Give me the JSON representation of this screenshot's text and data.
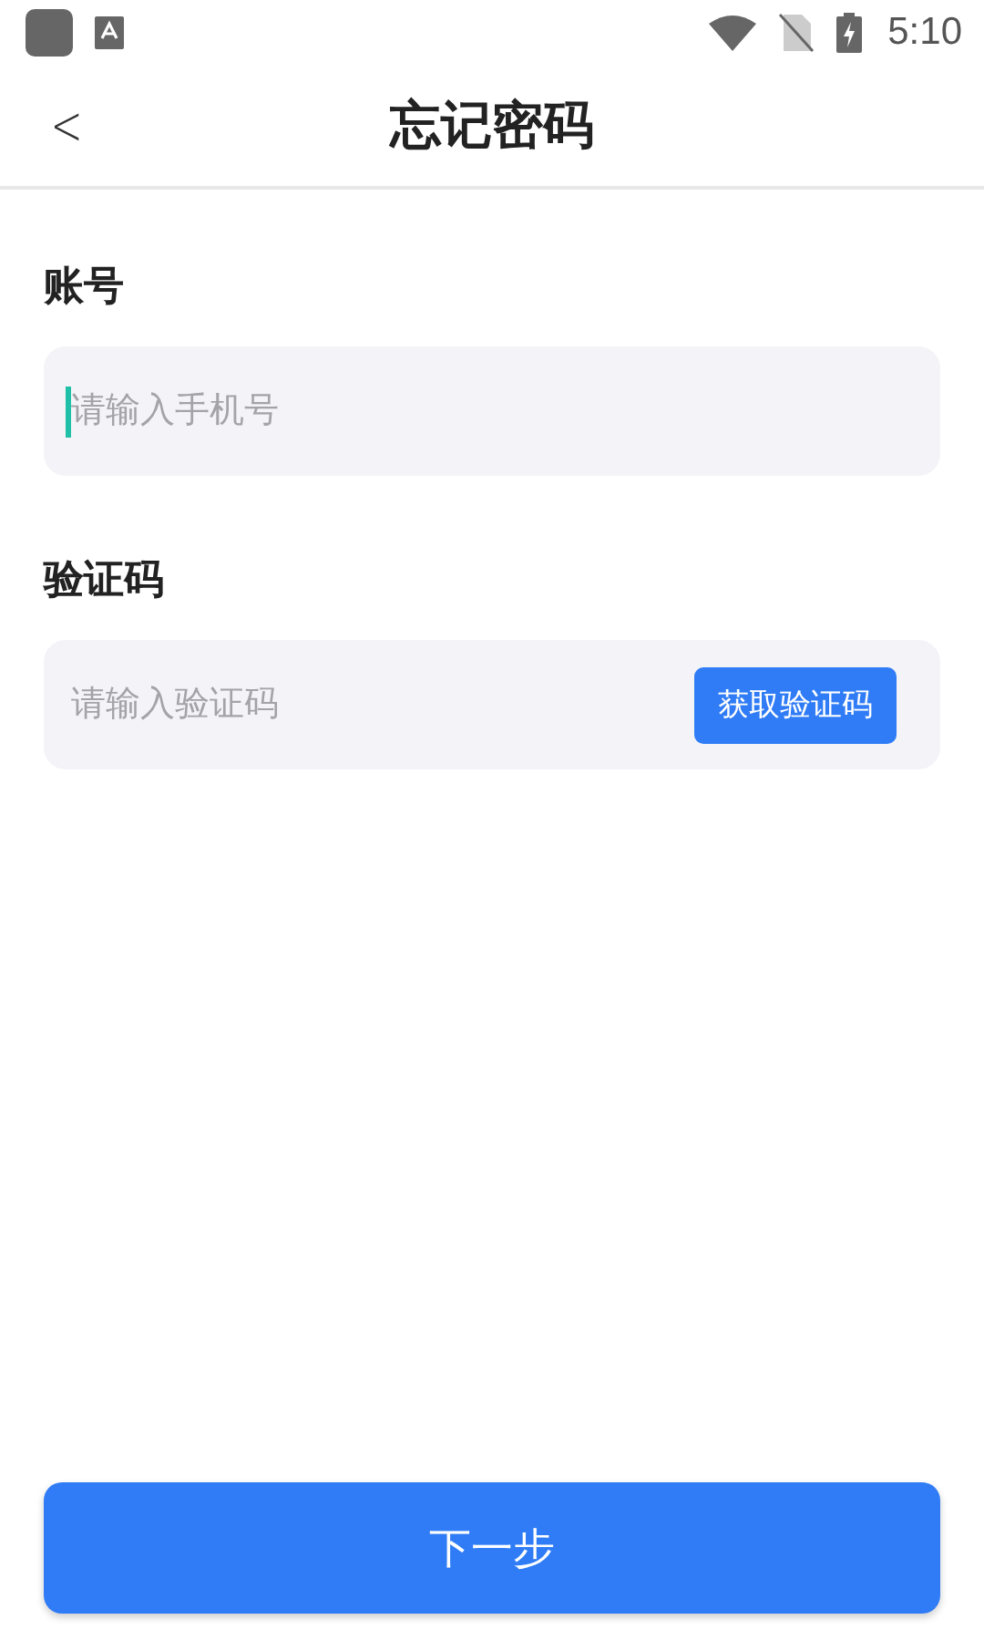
{
  "status_bar": {
    "time": "5:10"
  },
  "header": {
    "back": "<",
    "title": "忘记密码"
  },
  "fields": [
    {
      "label": "账号",
      "placeholder": "请输入手机号",
      "focused": true
    },
    {
      "label": "验证码",
      "placeholder": "请输入验证码",
      "focused": false,
      "action": "获取验证码"
    }
  ],
  "submit": "下一步"
}
